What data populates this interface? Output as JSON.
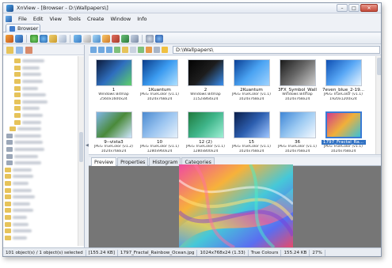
{
  "window": {
    "title": "XnView - [Browser - D:\\Wallpapers\\]",
    "controls": {
      "minimize": "–",
      "maximize": "□",
      "close": "✕"
    }
  },
  "menu": [
    "File",
    "Edit",
    "View",
    "Tools",
    "Create",
    "Window",
    "Info"
  ],
  "tab": {
    "label": "Browser"
  },
  "path": "D:\\Wallpapers\\",
  "thumbnails": [
    {
      "name": "1",
      "format": "Windows Bitmap",
      "dims": "2560x1600x24",
      "colors": [
        "#0c1a3a",
        "#2f6fbf",
        "#5fd06a"
      ]
    },
    {
      "name": "1Kuantum",
      "format": "JPEG TrueColor (v1.1)",
      "dims": "1024x768x24",
      "colors": [
        "#0a3c8a",
        "#3b9bf0",
        "#aee0ff"
      ]
    },
    {
      "name": "2",
      "format": "Windows Bitmap",
      "dims": "1152x864x24",
      "colors": [
        "#020202",
        "#1d1d1d",
        "#3a8ff0"
      ]
    },
    {
      "name": "2Kuantum",
      "format": "JPEG TrueColor (v1.1)",
      "dims": "1024x768x24",
      "colors": [
        "#0b3f95",
        "#4aa3f2",
        "#9fd3ff"
      ]
    },
    {
      "name": "3FX_Symbol_Wall",
      "format": "Windows Bitmap",
      "dims": "1024x768x24",
      "colors": [
        "#1a1a1a",
        "#6b6b6b",
        "#cfcfcf"
      ]
    },
    {
      "name": "7even_blue_2-19...",
      "format": "JPEG TrueColor (v1.1)",
      "dims": "1920x1200x24",
      "colors": [
        "#0e4fb3",
        "#58a7f5",
        "#e8f5ff"
      ]
    },
    {
      "name": "9--vista3",
      "format": "JPEG TrueColor (v1.2)",
      "dims": "1024x768x24",
      "colors": [
        "#7fb6e8",
        "#4a8a3a",
        "#cfe6ff"
      ]
    },
    {
      "name": "10",
      "format": "JPEG TrueColor (v1.1)",
      "dims": "1280x960x24",
      "colors": [
        "#4b8ad0",
        "#9ac4f0",
        "#e6f1fb"
      ]
    },
    {
      "name": "12 (2)",
      "format": "JPEG TrueColor (v1.1)",
      "dims": "1280x800x24",
      "colors": [
        "#1f7a3d",
        "#3fb58a",
        "#9ff0d5"
      ]
    },
    {
      "name": "15",
      "format": "JPEG TrueColor (v1.1)",
      "dims": "1024x768x24",
      "colors": [
        "#0a1e4a",
        "#2d5fb0",
        "#9fc6ff"
      ]
    },
    {
      "name": "36",
      "format": "JPEG TrueColor (v1.1)",
      "dims": "1024x768x24",
      "colors": [
        "#3e86d6",
        "#9ccaf2",
        "#f4f9ff"
      ]
    },
    {
      "name": "1797_Fractal_Ra...",
      "format": "JPEG TrueColor (v1.1)",
      "dims": "1024x768x24",
      "colors": [
        "#d13c8a",
        "#f0b03a",
        "#3ac0d8"
      ],
      "selected": true
    }
  ],
  "preview_tabs": [
    "Preview",
    "Properties",
    "Histogram",
    "Categories"
  ],
  "status": [
    "101 object(s) / 1 object(s) selected",
    "[155.24 KB]",
    "1797_Fractal_Rainbow_Ocean.jpg",
    "1024x768x24 (1.33)",
    "True Colours",
    "155.24 KB",
    "27%"
  ]
}
